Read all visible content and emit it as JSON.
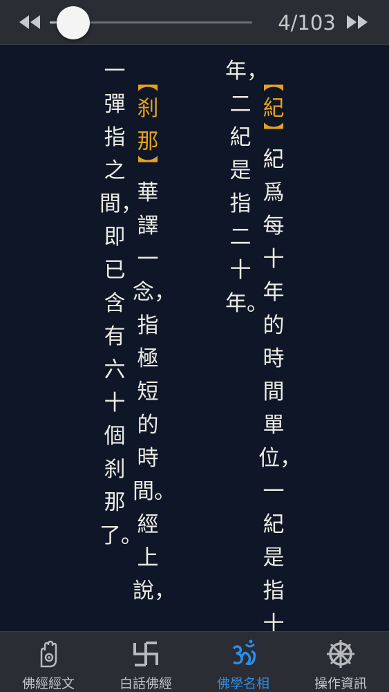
{
  "toolbar": {
    "page_counter": "4/103",
    "progress": 0.12,
    "prev_icon": "rewind-icon",
    "next_icon": "fast-forward-icon"
  },
  "entries": [
    {
      "term": "紀",
      "definition_lines": [
        "紀爲每十年的時間單位，一紀是指十",
        "年，二紀是指二十年。"
      ]
    },
    {
      "term": "刹那",
      "definition_lines": [
        "華譯一念，指極短的時間。經上說，",
        "一彈指之間，即已含有六十個刹那了。"
      ]
    }
  ],
  "tabs": [
    {
      "label": "佛經經文",
      "icon": "hand-icon",
      "active": false
    },
    {
      "label": "白話佛經",
      "icon": "manji-icon",
      "active": false
    },
    {
      "label": "佛學名相",
      "icon": "om-icon",
      "active": true
    },
    {
      "label": "操作資訊",
      "icon": "dharma-wheel-icon",
      "active": false
    }
  ],
  "colors": {
    "background": "#0e1627",
    "bar": "#2a2d33",
    "text": "#ecebe4",
    "term": "#e5a21f",
    "active_tab": "#2f8de8"
  }
}
